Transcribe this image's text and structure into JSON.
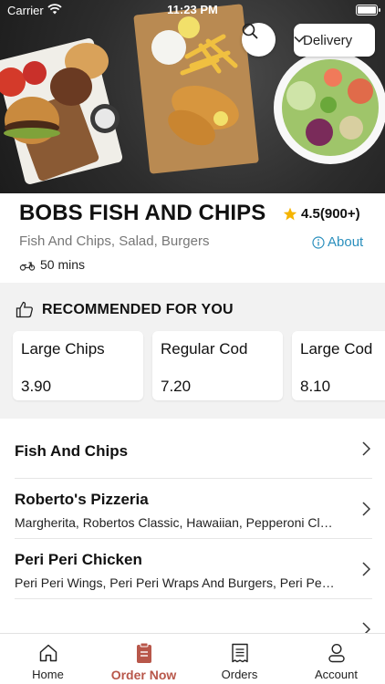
{
  "status_bar": {
    "carrier": "Carrier",
    "time": "11:23 PM"
  },
  "header": {
    "delivery_mode": "Delivery"
  },
  "restaurant": {
    "name": "BOBS FISH AND CHIPS",
    "rating": "4.5(900+)",
    "cuisines": "Fish And Chips, Salad, Burgers",
    "about_label": "About",
    "eta": "50 mins"
  },
  "recommended": {
    "heading": "RECOMMENDED FOR YOU",
    "items": [
      {
        "name": "Large Chips",
        "price": "3.90"
      },
      {
        "name": "Regular Cod",
        "price": "7.20"
      },
      {
        "name": "Large Cod",
        "price": "8.10"
      }
    ]
  },
  "categories": [
    {
      "title": "Fish And Chips",
      "subtitle": ""
    },
    {
      "title": "Roberto's Pizzeria",
      "subtitle": "Margherita, Robertos Classic, Hawaiian, Pepperoni Classic"
    },
    {
      "title": "Peri Peri Chicken",
      "subtitle": "Peri Peri Wings, Peri Peri Wraps And Burgers, Peri Peri Platters"
    }
  ],
  "tabs": [
    {
      "label": "Home",
      "icon": "home-icon",
      "active": false
    },
    {
      "label": "Order Now",
      "icon": "order-now-icon",
      "active": true
    },
    {
      "label": "Orders",
      "icon": "orders-receipt-icon",
      "active": false
    },
    {
      "label": "Account",
      "icon": "account-icon",
      "active": false
    }
  ],
  "colors": {
    "accent": "#B8574A",
    "link": "#2A8FBD",
    "star": "#F5B400",
    "section_bg": "#F2F2F2"
  }
}
